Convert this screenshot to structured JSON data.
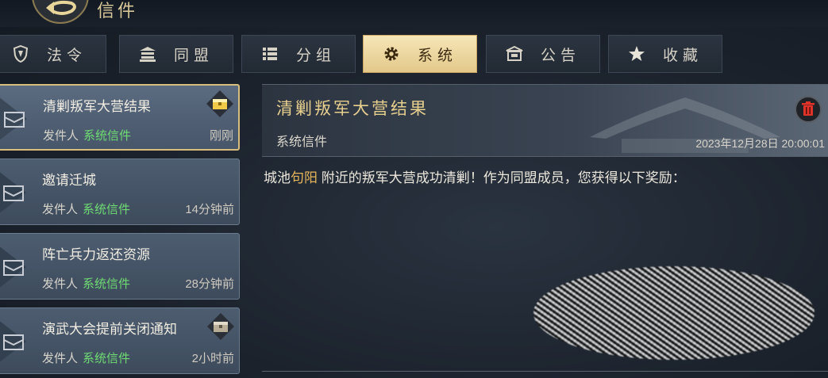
{
  "header": {
    "title": "信件"
  },
  "tabs": [
    {
      "label": "法令",
      "icon": "shield-icon"
    },
    {
      "label": "同盟",
      "icon": "alliance-hall-icon"
    },
    {
      "label": "分组",
      "icon": "list-icon"
    },
    {
      "label": "系统",
      "icon": "gear-icon",
      "active": true
    },
    {
      "label": "公告",
      "icon": "notice-board-icon"
    },
    {
      "label": "收藏",
      "icon": "star-icon"
    }
  ],
  "mail_list": [
    {
      "title": "清剿叛军大营结果",
      "sender_label": "发件人",
      "sender": "系统信件",
      "time": "刚刚",
      "has_attachment": true,
      "selected": true
    },
    {
      "title": "邀请迁城",
      "sender_label": "发件人",
      "sender": "系统信件",
      "time": "14分钟前",
      "has_attachment": false
    },
    {
      "title": "阵亡兵力返还资源",
      "sender_label": "发件人",
      "sender": "系统信件",
      "time": "28分钟前",
      "has_attachment": false
    },
    {
      "title": "演武大会提前关闭通知",
      "sender_label": "发件人",
      "sender": "系统信件",
      "time": "2小时前",
      "has_attachment": true
    }
  ],
  "detail": {
    "title": "清剿叛军大营结果",
    "sender": "系统信件",
    "date": "2023年12月28日 20:00:01",
    "body_prefix": "城池",
    "body_place": "句阳",
    "body_suffix": " 附近的叛军大营成功清剿！作为同盟成员，您获得以下奖励："
  },
  "colors": {
    "accent_gold": "#e3c88a",
    "sender_green": "#6fdc73",
    "place_orange": "#e8b65a"
  }
}
